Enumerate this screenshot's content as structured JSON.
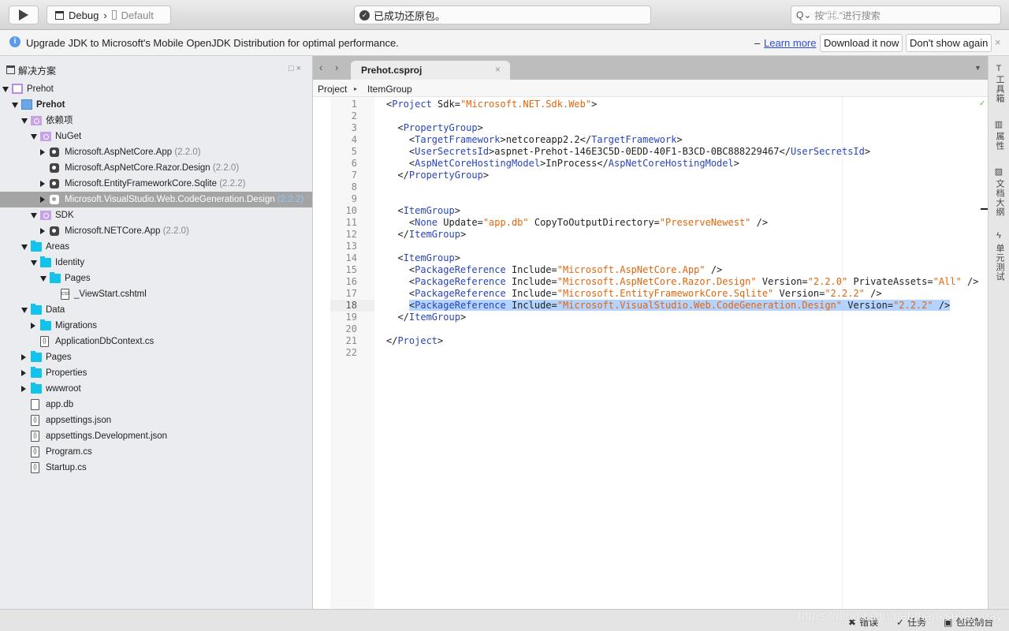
{
  "toolbar": {
    "config": "Debug",
    "separator": "›",
    "device": "Default",
    "status": "已成功还原包。",
    "search_placeholder": "按“⌘.”进行搜索"
  },
  "infobar": {
    "message": "Upgrade  JDK to Microsoft's Mobile OpenJDK Distribution for optimal performance.",
    "dash": "–",
    "learn_more": "Learn more",
    "download": "Download it now",
    "dont_show": "Don't show again",
    "close": "×"
  },
  "sidebar": {
    "title": "解决方案",
    "controls": "□×",
    "items": [
      {
        "label": "Prehot",
        "level": 0,
        "arrow": "down",
        "icon": "proj"
      },
      {
        "label": "Prehot",
        "level": 1,
        "arrow": "down",
        "icon": "proj2",
        "bold": true
      },
      {
        "label": "依赖项",
        "level": 2,
        "arrow": "down",
        "icon": "purple"
      },
      {
        "label": "NuGet",
        "level": 3,
        "arrow": "down",
        "icon": "purple"
      },
      {
        "label": "Microsoft.AspNetCore.App",
        "version": "(2.2.0)",
        "level": 4,
        "arrow": "right",
        "icon": "pkg"
      },
      {
        "label": "Microsoft.AspNetCore.Razor.Design",
        "version": "(2.2.0)",
        "level": 4,
        "arrow": "",
        "icon": "pkg"
      },
      {
        "label": "Microsoft.EntityFrameworkCore.Sqlite",
        "version": "(2.2.2)",
        "level": 4,
        "arrow": "right",
        "icon": "pkg"
      },
      {
        "label": "Microsoft.VisualStudio.Web.CodeGeneration.Design",
        "version": "(2.2.2)",
        "level": 4,
        "arrow": "right",
        "icon": "pkg",
        "selected": true
      },
      {
        "label": "SDK",
        "level": 3,
        "arrow": "down",
        "icon": "purple"
      },
      {
        "label": "Microsoft.NETCore.App",
        "version": "(2.2.0)",
        "level": 4,
        "arrow": "right",
        "icon": "pkg"
      },
      {
        "label": "Areas",
        "level": 2,
        "arrow": "down",
        "icon": "folder"
      },
      {
        "label": "Identity",
        "level": 3,
        "arrow": "down",
        "icon": "folder"
      },
      {
        "label": "Pages",
        "level": 4,
        "arrow": "down",
        "icon": "folder"
      },
      {
        "label": "_ViewStart.cshtml",
        "level": 5,
        "arrow": "",
        "icon": "css"
      },
      {
        "label": "Data",
        "level": 2,
        "arrow": "down",
        "icon": "folder"
      },
      {
        "label": "Migrations",
        "level": 3,
        "arrow": "right",
        "icon": "folder"
      },
      {
        "label": "ApplicationDbContext.cs",
        "level": 3,
        "arrow": "",
        "icon": "code"
      },
      {
        "label": "Pages",
        "level": 2,
        "arrow": "right",
        "icon": "folder"
      },
      {
        "label": "Properties",
        "level": 2,
        "arrow": "right",
        "icon": "folder"
      },
      {
        "label": "wwwroot",
        "level": 2,
        "arrow": "right",
        "icon": "folder"
      },
      {
        "label": "app.db",
        "level": 2,
        "arrow": "",
        "icon": "file"
      },
      {
        "label": "appsettings.json",
        "level": 2,
        "arrow": "",
        "icon": "code"
      },
      {
        "label": "appsettings.Development.json",
        "level": 2,
        "arrow": "",
        "icon": "code"
      },
      {
        "label": "Program.cs",
        "level": 2,
        "arrow": "",
        "icon": "code"
      },
      {
        "label": "Startup.cs",
        "level": 2,
        "arrow": "",
        "icon": "code"
      }
    ]
  },
  "editor": {
    "nav_back": "‹",
    "nav_forward": "›",
    "tab_title": "Prehot.csproj",
    "tab_close": "×",
    "breadcrumb": [
      "Project",
      "ItemGroup"
    ],
    "breadcrumb_sep": "▸",
    "current_line": 18,
    "lines": [
      [
        [
          "t",
          "<"
        ],
        [
          "g",
          "Project"
        ],
        [
          "t",
          " Sdk="
        ],
        [
          "s",
          "\"Microsoft.NET.Sdk.Web\""
        ],
        [
          "t",
          ">"
        ]
      ],
      [],
      [
        [
          "t",
          "  <"
        ],
        [
          "g",
          "PropertyGroup"
        ],
        [
          "t",
          ">"
        ]
      ],
      [
        [
          "t",
          "    <"
        ],
        [
          "g",
          "TargetFramework"
        ],
        [
          "t",
          ">netcoreapp2.2</"
        ],
        [
          "g",
          "TargetFramework"
        ],
        [
          "t",
          ">"
        ]
      ],
      [
        [
          "t",
          "    <"
        ],
        [
          "g",
          "UserSecretsId"
        ],
        [
          "t",
          ">aspnet-Prehot-146E3C5D-0EDD-40F1-B3CD-0BC888229467</"
        ],
        [
          "g",
          "UserSecretsId"
        ],
        [
          "t",
          ">"
        ]
      ],
      [
        [
          "t",
          "    <"
        ],
        [
          "g",
          "AspNetCoreHostingModel"
        ],
        [
          "t",
          ">InProcess</"
        ],
        [
          "g",
          "AspNetCoreHostingModel"
        ],
        [
          "t",
          ">"
        ]
      ],
      [
        [
          "t",
          "  </"
        ],
        [
          "g",
          "PropertyGroup"
        ],
        [
          "t",
          ">"
        ]
      ],
      [],
      [],
      [
        [
          "t",
          "  <"
        ],
        [
          "g",
          "ItemGroup"
        ],
        [
          "t",
          ">"
        ]
      ],
      [
        [
          "t",
          "    <"
        ],
        [
          "g",
          "None"
        ],
        [
          "t",
          " Update="
        ],
        [
          "s",
          "\"app.db\""
        ],
        [
          "t",
          " CopyToOutputDirectory="
        ],
        [
          "s",
          "\"PreserveNewest\""
        ],
        [
          "t",
          " />"
        ]
      ],
      [
        [
          "t",
          "  </"
        ],
        [
          "g",
          "ItemGroup"
        ],
        [
          "t",
          ">"
        ]
      ],
      [],
      [
        [
          "t",
          "  <"
        ],
        [
          "g",
          "ItemGroup"
        ],
        [
          "t",
          ">"
        ]
      ],
      [
        [
          "t",
          "    <"
        ],
        [
          "g",
          "PackageReference"
        ],
        [
          "t",
          " Include="
        ],
        [
          "s",
          "\"Microsoft.AspNetCore.App\""
        ],
        [
          "t",
          " />"
        ]
      ],
      [
        [
          "t",
          "    <"
        ],
        [
          "g",
          "PackageReference"
        ],
        [
          "t",
          " Include="
        ],
        [
          "s",
          "\"Microsoft.AspNetCore.Razor.Design\""
        ],
        [
          "t",
          " Version="
        ],
        [
          "s",
          "\"2.2.0\""
        ],
        [
          "t",
          " PrivateAssets="
        ],
        [
          "s",
          "\"All\""
        ],
        [
          "t",
          " />"
        ]
      ],
      [
        [
          "t",
          "    <"
        ],
        [
          "g",
          "PackageReference"
        ],
        [
          "t",
          " Include="
        ],
        [
          "s",
          "\"Microsoft.EntityFrameworkCore.Sqlite\""
        ],
        [
          "t",
          " Version="
        ],
        [
          "s",
          "\"2.2.2\""
        ],
        [
          "t",
          " />"
        ]
      ],
      [
        [
          "t",
          "    <"
        ],
        [
          "g",
          "PackageReference"
        ],
        [
          "t",
          " Include="
        ],
        [
          "s",
          "\"Microsoft.VisualStudio.Web.CodeGeneration.Design\""
        ],
        [
          "t",
          " Version="
        ],
        [
          "s",
          "\"2.2.2\""
        ],
        [
          "t",
          " />"
        ]
      ],
      [
        [
          "t",
          "  </"
        ],
        [
          "g",
          "ItemGroup"
        ],
        [
          "t",
          ">"
        ]
      ],
      [],
      [
        [
          "t",
          "</"
        ],
        [
          "g",
          "Project"
        ],
        [
          "t",
          ">"
        ]
      ],
      []
    ]
  },
  "right_panel": [
    {
      "label": "工具箱",
      "icon": "hammer-icon"
    },
    {
      "label": "属性",
      "icon": "properties-icon"
    },
    {
      "label": "文档大纲",
      "icon": "outline-icon"
    },
    {
      "label": "单元测试",
      "icon": "lightning-icon"
    }
  ],
  "statusbar": {
    "errors": "错误",
    "tasks": "任务",
    "console": "包控制台",
    "watermark": "https://blog.csdn.net/thankseveryday"
  },
  "colors": {
    "tag": "#2a45b8",
    "string": "#e2650c",
    "selection": "#b5d3ff",
    "folder": "#12c3ec",
    "link": "#2a4fd6"
  }
}
